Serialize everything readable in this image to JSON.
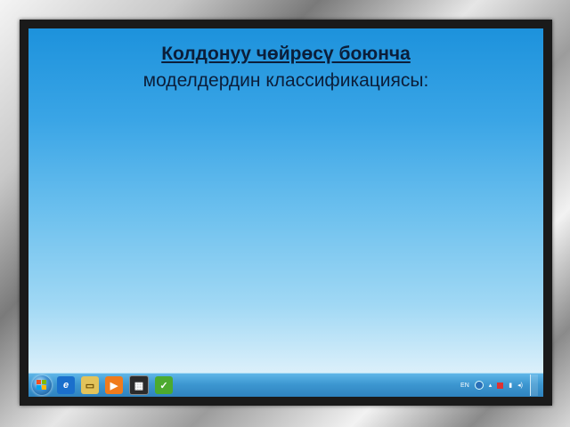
{
  "slide": {
    "title_line1": "Колдонуу чөйрөсү боюнча",
    "title_line2": "моделдердин классификациясы:"
  },
  "taskbar": {
    "language": "EN",
    "pinned_icons": [
      "internet-explorer-icon",
      "folder-icon",
      "media-player-icon",
      "calculator-icon",
      "app-icon"
    ],
    "tray_icons": [
      "help-icon",
      "arrow-up-icon",
      "flag-icon",
      "network-icon",
      "volume-icon"
    ]
  },
  "colors": {
    "screen_top": "#1d92dc",
    "screen_bottom": "#eaf6fc",
    "title_text": "#0b1e3a"
  }
}
